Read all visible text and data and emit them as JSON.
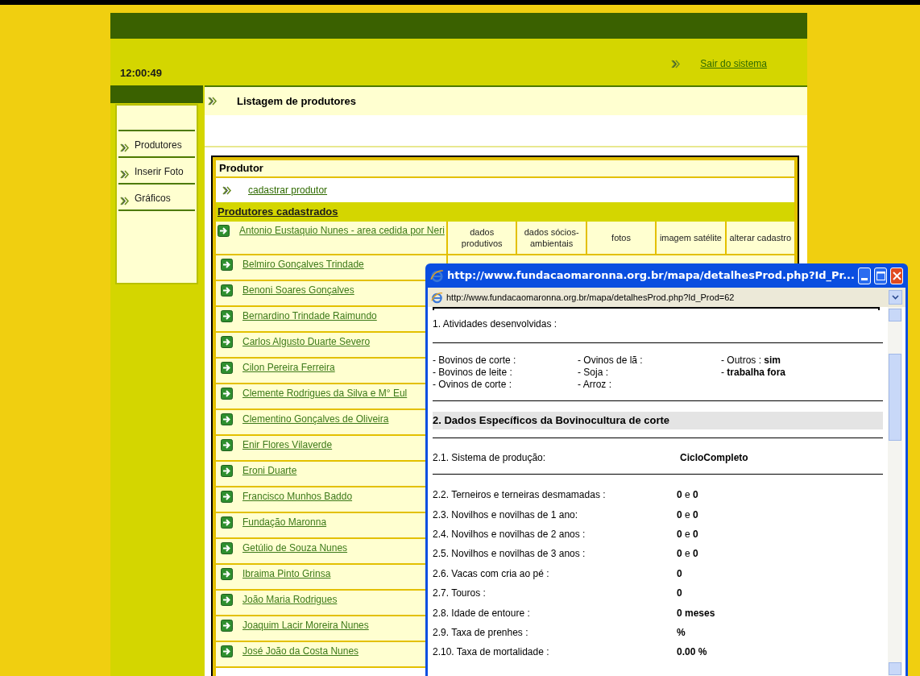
{
  "clock": "12:00:49",
  "logout_link": "Sair do sistema",
  "sidebar": {
    "items": [
      {
        "label": "Produtores"
      },
      {
        "label": "Inserir Foto"
      },
      {
        "label": "Gráficos"
      }
    ]
  },
  "page_title": "Listagem de produtores",
  "produtor_section": {
    "heading": "Produtor",
    "link": "cadastrar produtor"
  },
  "list_heading": "Produtores cadastrados",
  "table": {
    "rows": [
      {
        "name": "Antonio Eustaquio Nunes - area cedida por Neri",
        "actions": [
          "dados produtivos",
          "dados sócios-ambientais",
          "fotos",
          "imagem satélite",
          "alterar cadastro"
        ]
      },
      {
        "name": "Belmiro Gonçalves Trindade"
      },
      {
        "name": "Benoni Soares Gonçalves"
      },
      {
        "name": "Bernardino Trindade Raimundo"
      },
      {
        "name": "Carlos Algusto Duarte Severo"
      },
      {
        "name": "Cilon Pereira Ferreira"
      },
      {
        "name": "Clemente Rodrigues da Silva e M° Eul"
      },
      {
        "name": "Clementino Gonçalves de Oliveira"
      },
      {
        "name": "Enir Flores Vilaverde"
      },
      {
        "name": "Eroni Duarte"
      },
      {
        "name": "Francisco Munhos Baddo"
      },
      {
        "name": "Fundação Maronna"
      },
      {
        "name": "Getúlio de Souza Nunes"
      },
      {
        "name": "Ibraima Pinto Grinsa"
      },
      {
        "name": "João Maria Rodrigues"
      },
      {
        "name": "Joaquim Lacir Moreira Nunes"
      },
      {
        "name": "José João da Costa Nunes"
      }
    ]
  },
  "popup": {
    "title": "http://www.fundacaomaronna.org.br/mapa/detalhesProd.php?Id_Pr...",
    "address": "http://www.fundacaomaronna.org.br/mapa/detalhesProd.php?Id_Prod=62",
    "section_1": "1. Atividades desenvolvidas :",
    "activities": [
      [
        "- Bovinos de corte :",
        "- Bovinos de leite :",
        "- Ovinos de corte :"
      ],
      [
        "- Ovinos de lã :",
        "- Soja :",
        "- Arroz :"
      ],
      [
        "- Outros : **sim**",
        "- **trabalha fora**"
      ]
    ],
    "section_2": "2. Dados Específicos da Bovinocultura de corte",
    "system": {
      "label": "2.1. Sistema de produção:",
      "value": "CicloCompleto"
    },
    "items": [
      {
        "label": "2.2. Terneiros e terneiras desmamadas :",
        "value": "**0** e **0**"
      },
      {
        "label": "2.3. Novilhos e novilhas de 1 ano:",
        "value": "**0** e **0**"
      },
      {
        "label": "2.4. Novilhos e novilhas de 2 anos :",
        "value": "**0** e **0**"
      },
      {
        "label": "2.5. Novilhos e novilhas de 3 anos :",
        "value": "**0** e **0**"
      },
      {
        "label": "2.6. Vacas com cria ao pé :",
        "value": "**0**"
      },
      {
        "label": "2.7. Touros :",
        "value": "**0**"
      },
      {
        "label": "2.8. Idade de entoure :",
        "value": "**0 meses**"
      },
      {
        "label": "2.9. Taxa de prenhes :",
        "value": "**%**"
      },
      {
        "label": "2.10. Taxa de mortalidade :",
        "value": "**0.00 %**"
      }
    ]
  }
}
